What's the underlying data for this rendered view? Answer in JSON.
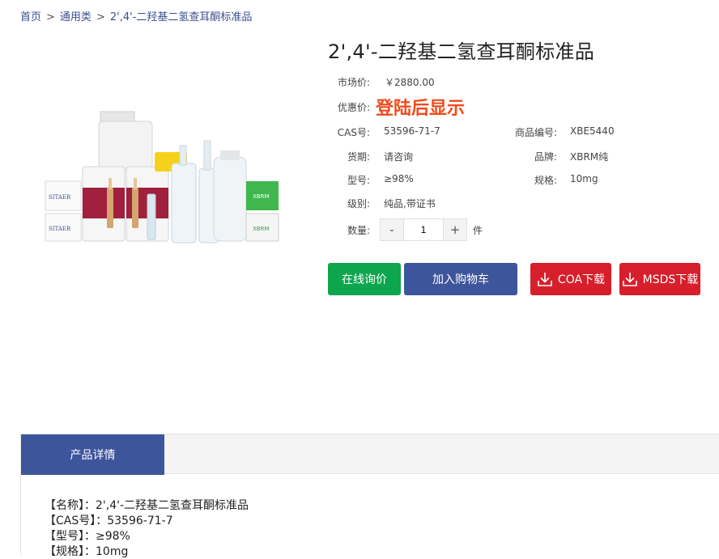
{
  "breadcrumb": {
    "home": "首页",
    "category": "通用类",
    "current": "2',4'-二羟基二氢查耳酮标准品",
    "separator": ">"
  },
  "product": {
    "title": "2',4'-二羟基二氢查耳酮标准品",
    "market_price_label": "市场价:",
    "market_price": "￥2880.00",
    "promo_label": "优惠价:",
    "promo_text": "登陆后显示",
    "cas_label": "CAS号:",
    "cas": "53596-71-7",
    "code_label": "商品编号:",
    "code": "XBE5440",
    "delivery_label": "货期:",
    "delivery": "请咨询",
    "brand_label": "品牌:",
    "brand": "XBRM纯",
    "model_label": "型号:",
    "model": "≥98%",
    "spec_label": "规格:",
    "spec": "10mg",
    "grade_label": "级别:",
    "grade": "纯品,带证书",
    "qty_label": "数量:",
    "qty_minus": "-",
    "qty_value": "1",
    "qty_plus": "+",
    "qty_unit": "件"
  },
  "actions": {
    "inquiry": "在线询价",
    "add_cart": "加入购物车",
    "coa": "COA下载",
    "msds": "MSDS下载"
  },
  "detail": {
    "tab": "产品详情",
    "lines": [
      "【名称】：2',4'-二羟基二氢查耳酮标准品",
      "【CAS号】：53596-71-7",
      "【型号】：≥98%",
      "【规格】：10mg"
    ]
  },
  "image_labels": {
    "sitaer1": "SITAER",
    "sitaer2": "SITAER",
    "xbrm1": "XBRM",
    "xbrm2": "XBRM"
  },
  "colors": {
    "green": "#0da64f",
    "blue": "#3d559b",
    "red": "#d71f2b",
    "promo": "#f04a1b"
  },
  "icons": [
    "download-icon"
  ]
}
